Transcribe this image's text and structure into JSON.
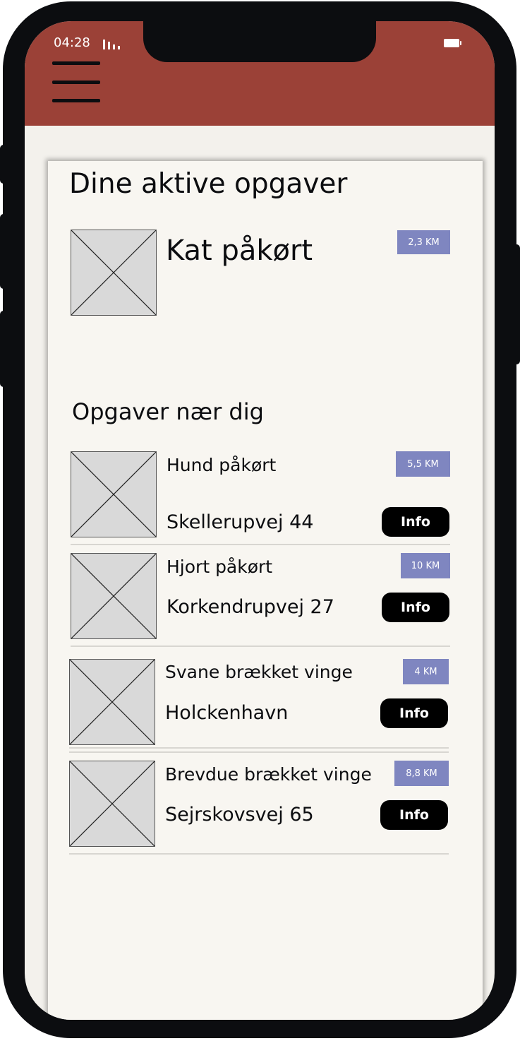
{
  "status_bar": {
    "time": "04:28"
  },
  "header": {
    "menu_icon": "hamburger-menu-icon",
    "color": "#9b4137"
  },
  "active_section": {
    "title": "Dine aktive opgaver",
    "task": {
      "title": "Kat påkørt",
      "distance": "2,3 KM"
    }
  },
  "nearby_section": {
    "title": "Opgaver nær dig",
    "tasks": [
      {
        "title": "Hund påkørt",
        "address": "Skellerupvej 44",
        "distance": "5,5 KM",
        "button": "Info"
      },
      {
        "title": "Hjort påkørt",
        "address": "Korkendrupvej 27",
        "distance": "10 KM",
        "button": "Info"
      },
      {
        "title": "Svane brækket vinge",
        "address": "Holckenhavn",
        "distance": "4 KM",
        "button": "Info"
      },
      {
        "title": "Brevdue brækket vinge",
        "address": "Sejrskovsvej 65",
        "distance": "8,8 KM",
        "button": "Info"
      }
    ]
  },
  "colors": {
    "badge": "#7f86c0",
    "background": "#f8f6f1",
    "button": "#000000"
  }
}
